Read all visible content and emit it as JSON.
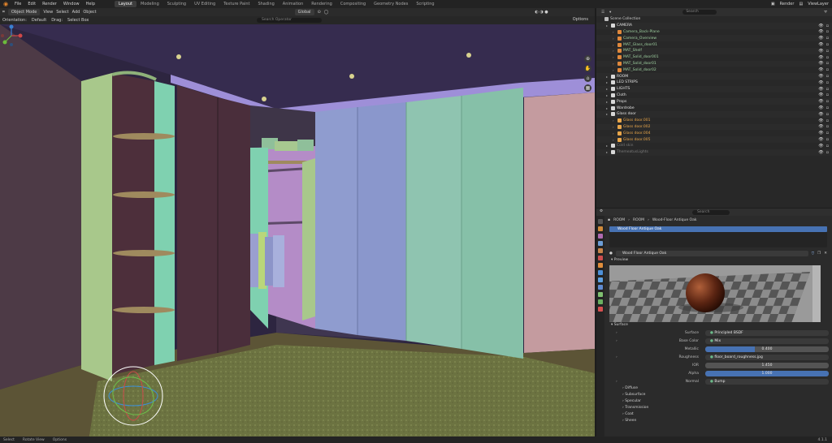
{
  "topbar": {
    "menus": [
      "File",
      "Edit",
      "Render",
      "Window",
      "Help"
    ],
    "workspaces": [
      "Layout",
      "Modeling",
      "Sculpting",
      "UV Editing",
      "Texture Paint",
      "Shading",
      "Animation",
      "Rendering",
      "Compositing",
      "Geometry Nodes",
      "Scripting"
    ],
    "active_workspace": "Layout",
    "scene": "Render",
    "view_layer": "ViewLayer"
  },
  "viewport_header": {
    "mode": "Object Mode",
    "menus": [
      "View",
      "Select",
      "Add",
      "Object"
    ],
    "transform": "Global"
  },
  "viewport_toolbar": {
    "orientation": "Orientation:",
    "orientation_value": "Default",
    "drag": "Drag:",
    "drag_value": "Select Box",
    "search_placeholder": "Search Operator",
    "options": "Options"
  },
  "outliner": {
    "search_placeholder": "Search",
    "items": [
      {
        "name": "Scene Collection",
        "depth": 0,
        "kind": "scene"
      },
      {
        "name": "CAMERA",
        "depth": 1,
        "kind": "collection"
      },
      {
        "name": "Camera_Back-Plane",
        "depth": 2,
        "kind": "camera"
      },
      {
        "name": "Camera_Overview",
        "depth": 2,
        "kind": "camera"
      },
      {
        "name": "MAT_Glass_door01",
        "depth": 2,
        "kind": "camera"
      },
      {
        "name": "MAT_Shelf",
        "depth": 2,
        "kind": "camera"
      },
      {
        "name": "MAT_Solid_door001",
        "depth": 2,
        "kind": "camera"
      },
      {
        "name": "MAT_Solid_door01",
        "depth": 2,
        "kind": "camera"
      },
      {
        "name": "MAT_Solid_door02",
        "depth": 2,
        "kind": "camera"
      },
      {
        "name": "ROOM",
        "depth": 1,
        "kind": "collection"
      },
      {
        "name": "LED STRIPS",
        "depth": 1,
        "kind": "collection"
      },
      {
        "name": "LIGHTS",
        "depth": 1,
        "kind": "collection"
      },
      {
        "name": "Cloth",
        "depth": 1,
        "kind": "collection"
      },
      {
        "name": "Props",
        "depth": 1,
        "kind": "collection"
      },
      {
        "name": "Wardrobe",
        "depth": 1,
        "kind": "collection"
      },
      {
        "name": "Glass door",
        "depth": 1,
        "kind": "collection"
      },
      {
        "name": "Glass door.001",
        "depth": 2,
        "kind": "mesh"
      },
      {
        "name": "Glass door.002",
        "depth": 2,
        "kind": "mesh"
      },
      {
        "name": "Glass door.004",
        "depth": 2,
        "kind": "mesh"
      },
      {
        "name": "Glass door.005",
        "depth": 2,
        "kind": "mesh"
      },
      {
        "name": "Cold skin",
        "depth": 1,
        "kind": "collection_dim"
      },
      {
        "name": "ThemeatusLights",
        "depth": 1,
        "kind": "collection_dim"
      }
    ]
  },
  "properties": {
    "search_placeholder": "Search",
    "breadcrumb": [
      "ROOM",
      "ROOM",
      "Wood-Floor Antique Oak"
    ],
    "slot": "Wood Floor Antique Oak",
    "material_name": "Wood Floor Antique Oak",
    "preview_label": "Preview",
    "surface_section": "Surface",
    "fields": [
      {
        "label": "Surface",
        "value": "Principled BSDF",
        "type": "node"
      },
      {
        "label": "Base Color",
        "value": "Mix",
        "type": "node"
      },
      {
        "label": "Metallic",
        "value": "0.400",
        "type": "slider",
        "fraction": 0.4
      },
      {
        "label": "Roughness",
        "value": "floor_board_roughness.jpg",
        "type": "node"
      },
      {
        "label": "IOR",
        "value": "1.450",
        "type": "number"
      },
      {
        "label": "Alpha",
        "value": "1.000",
        "type": "slider",
        "fraction": 1.0
      },
      {
        "label": "Normal",
        "value": "Bump",
        "type": "node"
      }
    ],
    "subsections": [
      "Diffuse",
      "Subsurface",
      "Specular",
      "Transmission",
      "Coat",
      "Sheen"
    ]
  },
  "statusbar": {
    "left": [
      "Select",
      "Rotate View",
      "Options"
    ],
    "version": "4.1.1"
  },
  "colors": {
    "accent": "#4772b3",
    "ceiling": "#3a2f55",
    "wall_left": "#4e3a46",
    "wall_right": "#c39a9e",
    "carpet": "#6e7543",
    "door_blue": "#8f9ccf",
    "door_green": "#8fc4b0",
    "shelf_green": "#a8c88b",
    "mint": "#7fd1b0",
    "soffit": "#9f8fd9"
  }
}
